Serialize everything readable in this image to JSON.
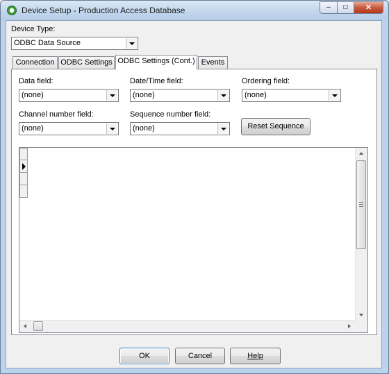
{
  "window": {
    "title": "Device Setup - Production Access Database",
    "caption_buttons": {
      "minimize": "–",
      "maximize": "□",
      "close": "✕"
    }
  },
  "device_type": {
    "label": "Device Type:",
    "value": "ODBC Data Source"
  },
  "tabs": [
    {
      "label": "Connection",
      "active": false
    },
    {
      "label": "ODBC Settings",
      "active": false
    },
    {
      "label": "ODBC Settings (Cont.)",
      "active": true
    },
    {
      "label": "Events",
      "active": false
    }
  ],
  "fields": {
    "data_field": {
      "label": "Data field:",
      "value": "(none)"
    },
    "datetime_field": {
      "label": "Date/Time field:",
      "value": "(none)"
    },
    "ordering_field": {
      "label": "Ordering field:",
      "value": "(none)"
    },
    "channel_number_field": {
      "label": "Channel number field:",
      "value": "(none)"
    },
    "sequence_number_field": {
      "label": "Sequence number field:",
      "value": "(none)"
    }
  },
  "reset_sequence_label": "Reset Sequence",
  "buttons": {
    "ok": "OK",
    "cancel": "Cancel",
    "help": "Help"
  },
  "colors": {
    "accent_frame": "#bcd3ec",
    "close_button": "#c75b3e",
    "default_button_border": "#3c7fb1"
  }
}
